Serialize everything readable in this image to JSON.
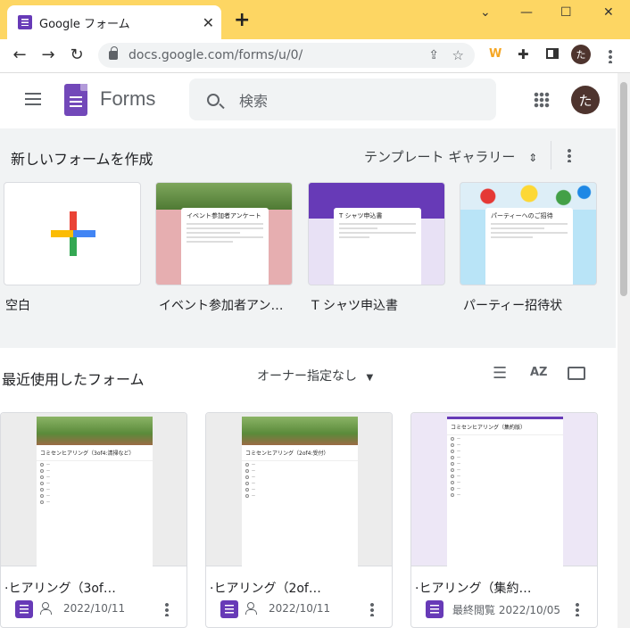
{
  "browser": {
    "tab_title": "Google フォーム",
    "new_tab": "+",
    "url": "docs.google.com/forms/u/0/",
    "window_controls": [
      "⌄",
      "—",
      "☐",
      "✕"
    ],
    "profile_initial": "た"
  },
  "header": {
    "brand": "Forms",
    "search_placeholder": "検索",
    "avatar_initial": "た"
  },
  "templates": {
    "title": "新しいフォームを作成",
    "gallery_label": "テンプレート ギャラリー",
    "items": [
      {
        "label": "空白"
      },
      {
        "label": "イベント参加者アン…",
        "preview_title": "イベント参加者アンケート"
      },
      {
        "label": "T シャツ申込書",
        "preview_title": "T シャツ申込書"
      },
      {
        "label": "パーティー招待状",
        "preview_title": "パーティーへのご招待"
      }
    ]
  },
  "recent": {
    "title": "最近使用したフォーム",
    "owner_filter": "オーナー指定なし",
    "forms": [
      {
        "name": "·ヒアリング（3of…",
        "date": "2022/10/11",
        "shared": true,
        "preview_title": "コミセンヒアリング（3of4:清掃など）"
      },
      {
        "name": "·ヒアリング（2of…",
        "date": "2022/10/11",
        "shared": true,
        "preview_title": "コミセンヒアリング（2of4:受付）"
      },
      {
        "name": "·ヒアリング（集約…",
        "date": "最終閲覧 2022/10/05",
        "shared": false,
        "preview_title": "コミセンヒアリング（集約版）"
      }
    ]
  },
  "colors": {
    "accent": "#673ab7",
    "tab_bar": "#fdd663",
    "avatar": "#4e342e"
  }
}
